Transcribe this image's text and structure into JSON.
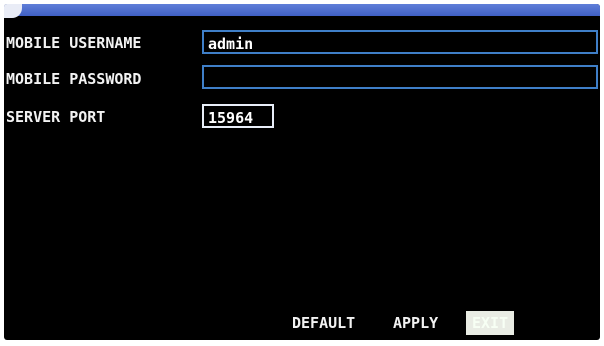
{
  "form": {
    "username_label": "MOBILE USERNAME",
    "username_value": "admin",
    "password_label": "MOBILE PASSWORD",
    "password_value": "",
    "port_label": "SERVER PORT",
    "port_value": "15964"
  },
  "footer": {
    "default_label": "DEFAULT",
    "apply_label": "APPLY",
    "exit_label": "EXIT"
  },
  "colors": {
    "background": "#000000",
    "field_border": "#3f7fc8",
    "selected_button": "#e9ece4",
    "title_bar": "#4a68cc"
  }
}
